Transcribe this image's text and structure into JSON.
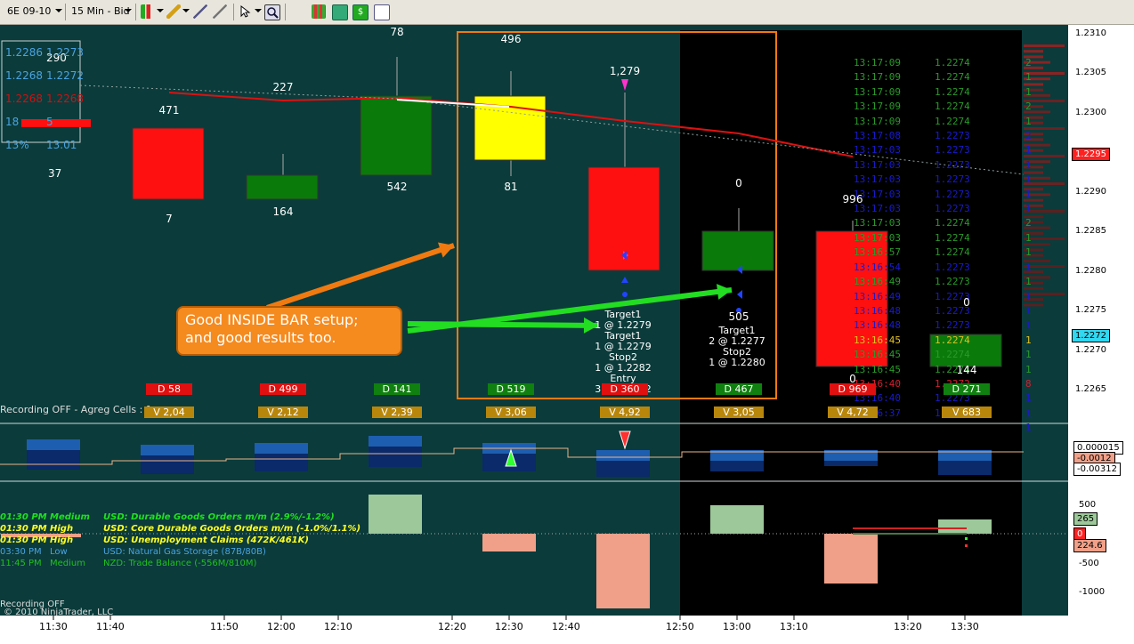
{
  "toolbar": {
    "instrument": "6E 09-10",
    "timeframe": "15 Min - Bid",
    "icons": [
      "bar-type-icon",
      "draw-pencil-icon",
      "attach-icon",
      "drawing-tools-icon",
      "cursor-icon",
      "zoom-icon",
      "instrument-icon",
      "chart-data-icon",
      "properties-icon",
      "strategy-icon",
      "blank-doc-icon"
    ]
  },
  "status": {
    "recording_main": "Recording OFF - Agreg Cells : 1",
    "recording_lower": "Recording OFF",
    "copyright": "© 2010 NinjaTrader, LLC"
  },
  "info_box": {
    "rows": [
      {
        "a": "1.2286",
        "b": "1.2273",
        "color": "#4aa3e0"
      },
      {
        "a": "1.2268",
        "b": "1.2272",
        "color": "#4aa3e0"
      },
      {
        "a": "1.2268",
        "b": "1.2268",
        "color": "#d01010"
      },
      {
        "a": "18",
        "b": "5",
        "color": "#4aa3e0"
      },
      {
        "a": "13%",
        "b": "13.01",
        "color": "#4aa3e0"
      }
    ],
    "overlay_value": "290"
  },
  "candles": [
    {
      "time": "11:40",
      "top_label": "471",
      "bottom_label": "7",
      "delta": "D 58",
      "delta_color": "#e01010",
      "volume": "V 2,04"
    },
    {
      "time": "11:50",
      "top_label": "227",
      "bottom_label": "164",
      "delta": "D 499",
      "delta_color": "#e01010",
      "volume": "V 2,12"
    },
    {
      "time": "12:00",
      "top_label": "78",
      "bottom_label": "542",
      "delta": "D 141",
      "delta_color": "#108010",
      "volume": "V 2,39"
    },
    {
      "time": "12:20",
      "top_label": "496",
      "bottom_label": "81",
      "delta": "D 519",
      "delta_color": "#108010",
      "volume": "V 3,06"
    },
    {
      "time": "12:40",
      "top_label": "1,279",
      "bottom_label": "",
      "delta": "D 360",
      "delta_color": "#e01010",
      "volume": "V 4,92"
    },
    {
      "time": "13:00",
      "top_label": "0",
      "bottom_label": "505",
      "delta": "D 467",
      "delta_color": "#108010",
      "volume": "V 3,05"
    },
    {
      "time": "13:10",
      "top_label": "996",
      "bottom_label": "0",
      "delta": "D 969",
      "delta_color": "#e01010",
      "volume": "V 4,72"
    },
    {
      "time": "13:20",
      "top_label": "0",
      "bottom_label": "144",
      "delta": "D 271",
      "delta_color": "#108010",
      "volume": "V 683"
    }
  ],
  "extra_labels": {
    "left_small": "37"
  },
  "orders_bar5": [
    "Target1",
    "1 @ 1.2279",
    "Target1",
    "1 @ 1.2279",
    "Stop2",
    "1 @ 1.2282",
    "Entry",
    "3 @ 1.2282"
  ],
  "orders_bar6": [
    "Target1",
    "2 @ 1.2277",
    "Stop2",
    "1 @ 1.2280"
  ],
  "callout": {
    "text_line1": "Good INSIDE BAR setup;",
    "text_line2": "and good results too."
  },
  "time_and_sales": [
    {
      "time": "13:17:09",
      "price": "1.2274",
      "color": "#2a9a2a"
    },
    {
      "time": "13:17:09",
      "price": "1.2274",
      "color": "#2a9a2a"
    },
    {
      "time": "13:17:09",
      "price": "1.2274",
      "color": "#2a9a2a"
    },
    {
      "time": "13:17:09",
      "price": "1.2274",
      "color": "#2a9a2a"
    },
    {
      "time": "13:17:09",
      "price": "1.2274",
      "color": "#2a9a2a"
    },
    {
      "time": "13:17:08",
      "price": "1.2273",
      "color": "#1a1acc"
    },
    {
      "time": "13:17:03",
      "price": "1.2273",
      "color": "#1a1acc"
    },
    {
      "time": "13:17:03",
      "price": "1.2273",
      "color": "#1a1acc"
    },
    {
      "time": "13:17:03",
      "price": "1.2273",
      "color": "#1a1acc"
    },
    {
      "time": "13:17:03",
      "price": "1.2273",
      "color": "#1a1acc"
    },
    {
      "time": "13:17:03",
      "price": "1.2273",
      "color": "#1a1acc"
    },
    {
      "time": "13:17:03",
      "price": "1.2274",
      "color": "#2a9a2a"
    },
    {
      "time": "13:17:03",
      "price": "1.2274",
      "color": "#2a9a2a"
    },
    {
      "time": "13:16:57",
      "price": "1.2274",
      "color": "#2a9a2a"
    },
    {
      "time": "13:16:54",
      "price": "1.2273",
      "color": "#1a1acc"
    },
    {
      "time": "13:16:49",
      "price": "1.2273",
      "color": "#2a9a2a"
    },
    {
      "time": "13:16:49",
      "price": "1.2273",
      "color": "#1a1acc"
    },
    {
      "time": "13:16:48",
      "price": "1.2273",
      "color": "#1a1acc"
    },
    {
      "time": "13:16:48",
      "price": "1.2273",
      "color": "#1a1acc"
    },
    {
      "time": "13:16:45",
      "price": "1.2274",
      "color": "#e0c020"
    },
    {
      "time": "13:16:45",
      "price": "1.2274",
      "color": "#2a9a2a"
    },
    {
      "time": "13:16:45",
      "price": "1.2274",
      "color": "#2a9a2a"
    },
    {
      "time": "13:16:40",
      "price": "1.2272",
      "color": "#d02030"
    },
    {
      "time": "13:16:40",
      "price": "1.2273",
      "color": "#1a1acc"
    },
    {
      "time": "13:16:37",
      "price": "1.2273",
      "color": "#1a1acc"
    }
  ],
  "tape_sizes": [
    "2",
    "1",
    "1",
    "2",
    "1",
    "2",
    "1",
    "1",
    "1",
    "1",
    "1",
    "2",
    "1",
    "1",
    "1",
    "1",
    "1",
    "1",
    "1",
    "1",
    "1",
    "1",
    "8",
    "1",
    "1",
    "1"
  ],
  "news": [
    {
      "time": "01:30 PM",
      "impact": "Medium",
      "text": "USD: Durable Goods Orders m/m (2.9%/-1.2%)",
      "color": "#20e020"
    },
    {
      "time": "01:30 PM",
      "impact": "High",
      "text": "USD: Core Durable Goods Orders m/m (-1.0%/1.1%)",
      "color": "#ffff20"
    },
    {
      "time": "01:30 PM",
      "impact": "High",
      "text": "USD: Unemployment Claims (472K/461K)",
      "color": "#ffff20"
    }
  ],
  "news_plain": [
    {
      "time": "03:30 PM",
      "impact": "Low",
      "text": "USD: Natural Gas Storage (87B/80B)",
      "color": "#4aa3e0"
    },
    {
      "time": "11:45 PM",
      "impact": "Medium",
      "text": "NZD: Trade Balance (-556M/810M)",
      "color": "#20c020"
    }
  ],
  "price_axis": {
    "ticks": [
      "1.2310",
      "1.2305",
      "1.2300",
      "1.2295",
      "1.2290",
      "1.2285",
      "1.2280",
      "1.2275",
      "1.2270",
      "1.2265"
    ],
    "tag_last": "1.2295",
    "tag_bid": "1.2272"
  },
  "mid_axis": {
    "tags": [
      "0.000015",
      "-0.0012",
      "-0.00312"
    ]
  },
  "low_axis": {
    "ticks": [
      "500",
      "0",
      "-500",
      "-1000"
    ],
    "tags": [
      "265",
      "0",
      "224.6"
    ]
  },
  "x_axis": {
    "ticks": [
      "11:30",
      "11:40",
      "11:50",
      "12:00",
      "12:10",
      "12:20",
      "12:30",
      "12:40",
      "12:50",
      "13:00",
      "13:10",
      "13:20",
      "13:30"
    ]
  },
  "colors": {
    "background": "#0b3b3b",
    "session_black": "#000000",
    "bull": "#0a7a0a",
    "bear": "#ff1010",
    "inside": "#ffff00",
    "highlight_box": "#f07a10",
    "arrow_green": "#22dd22"
  }
}
